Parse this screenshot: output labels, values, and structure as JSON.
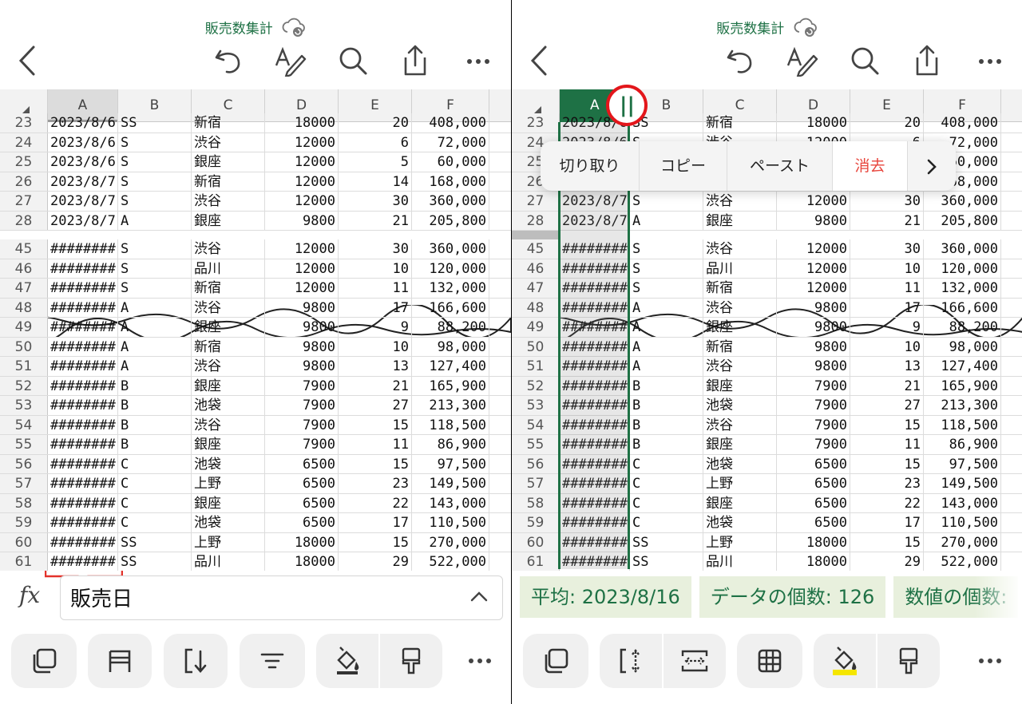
{
  "doc_title": "販売数集計",
  "columns": [
    "A",
    "B",
    "C",
    "D",
    "E",
    "F"
  ],
  "rows_top": [
    {
      "n": "23",
      "a": "2023/8/6",
      "b": "SS",
      "c": "新宿",
      "d": "18000",
      "e": "20",
      "f": "408,000"
    },
    {
      "n": "24",
      "a": "2023/8/6",
      "b": "S",
      "c": "渋谷",
      "d": "12000",
      "e": "6",
      "f": "72,000"
    },
    {
      "n": "25",
      "a": "2023/8/6",
      "b": "S",
      "c": "銀座",
      "d": "12000",
      "e": "5",
      "f": "60,000"
    },
    {
      "n": "26",
      "a": "2023/8/7",
      "b": "S",
      "c": "新宿",
      "d": "12000",
      "e": "14",
      "f": "168,000"
    },
    {
      "n": "27",
      "a": "2023/8/7",
      "b": "S",
      "c": "渋谷",
      "d": "12000",
      "e": "30",
      "f": "360,000"
    },
    {
      "n": "28",
      "a": "2023/8/7",
      "b": "A",
      "c": "銀座",
      "d": "9800",
      "e": "21",
      "f": "205,800"
    }
  ],
  "rows_bottom": [
    {
      "n": "45",
      "a": "########",
      "b": "S",
      "c": "渋谷",
      "d": "12000",
      "e": "30",
      "f": "360,000"
    },
    {
      "n": "46",
      "a": "########",
      "b": "S",
      "c": "品川",
      "d": "12000",
      "e": "10",
      "f": "120,000"
    },
    {
      "n": "47",
      "a": "########",
      "b": "S",
      "c": "新宿",
      "d": "12000",
      "e": "11",
      "f": "132,000"
    },
    {
      "n": "48",
      "a": "########",
      "b": "A",
      "c": "渋谷",
      "d": "9800",
      "e": "17",
      "f": "166,600"
    },
    {
      "n": "49",
      "a": "########",
      "b": "A",
      "c": "銀座",
      "d": "9800",
      "e": "9",
      "f": "88,200"
    },
    {
      "n": "50",
      "a": "########",
      "b": "A",
      "c": "新宿",
      "d": "9800",
      "e": "10",
      "f": "98,000"
    },
    {
      "n": "51",
      "a": "########",
      "b": "A",
      "c": "渋谷",
      "d": "9800",
      "e": "13",
      "f": "127,400"
    },
    {
      "n": "52",
      "a": "########",
      "b": "B",
      "c": "銀座",
      "d": "7900",
      "e": "21",
      "f": "165,900"
    },
    {
      "n": "53",
      "a": "########",
      "b": "B",
      "c": "池袋",
      "d": "7900",
      "e": "27",
      "f": "213,300"
    },
    {
      "n": "54",
      "a": "########",
      "b": "B",
      "c": "渋谷",
      "d": "7900",
      "e": "15",
      "f": "118,500"
    },
    {
      "n": "55",
      "a": "########",
      "b": "B",
      "c": "銀座",
      "d": "7900",
      "e": "11",
      "f": "86,900"
    },
    {
      "n": "56",
      "a": "########",
      "b": "C",
      "c": "池袋",
      "d": "6500",
      "e": "15",
      "f": "97,500"
    },
    {
      "n": "57",
      "a": "########",
      "b": "C",
      "c": "上野",
      "d": "6500",
      "e": "23",
      "f": "149,500"
    },
    {
      "n": "58",
      "a": "########",
      "b": "C",
      "c": "銀座",
      "d": "6500",
      "e": "22",
      "f": "143,000"
    },
    {
      "n": "59",
      "a": "########",
      "b": "C",
      "c": "池袋",
      "d": "6500",
      "e": "17",
      "f": "110,500"
    },
    {
      "n": "60",
      "a": "########",
      "b": "SS",
      "c": "上野",
      "d": "18000",
      "e": "15",
      "f": "270,000"
    },
    {
      "n": "61",
      "a": "########",
      "b": "SS",
      "c": "品川",
      "d": "18000",
      "e": "29",
      "f": "522,000"
    }
  ],
  "formula_bar": {
    "fx_label": "fx",
    "value": "販売日"
  },
  "context_menu": [
    "切り取り",
    "コピー",
    "ペースト",
    "消去"
  ],
  "status_chips": [
    "平均: 2023/8/16",
    "データの個数: 126",
    "数値の個数:"
  ],
  "col_resize_handle": "||",
  "colors": {
    "accent": "#1e7145",
    "header_bg": "#f2f2f2",
    "status_bg": "#e8f0dd",
    "highlight": "#e8453c",
    "danger": "#e8453c"
  },
  "icons_left_toolbar": [
    "back-chevron-icon",
    "undo-icon",
    "draw-pen-icon",
    "search-icon",
    "share-icon",
    "more-icon"
  ],
  "icons_left_bottom": [
    "duplicate-icon",
    "freeze-panes-icon",
    "sort-icon",
    "filter-icon",
    "fill-color-icon",
    "format-painter-icon",
    "more-icon"
  ],
  "icons_right_bottom": [
    "duplicate-icon",
    "autofit-column-width-icon",
    "column-width-icon",
    "borders-icon",
    "fill-color-icon",
    "format-painter-icon",
    "more-icon"
  ]
}
